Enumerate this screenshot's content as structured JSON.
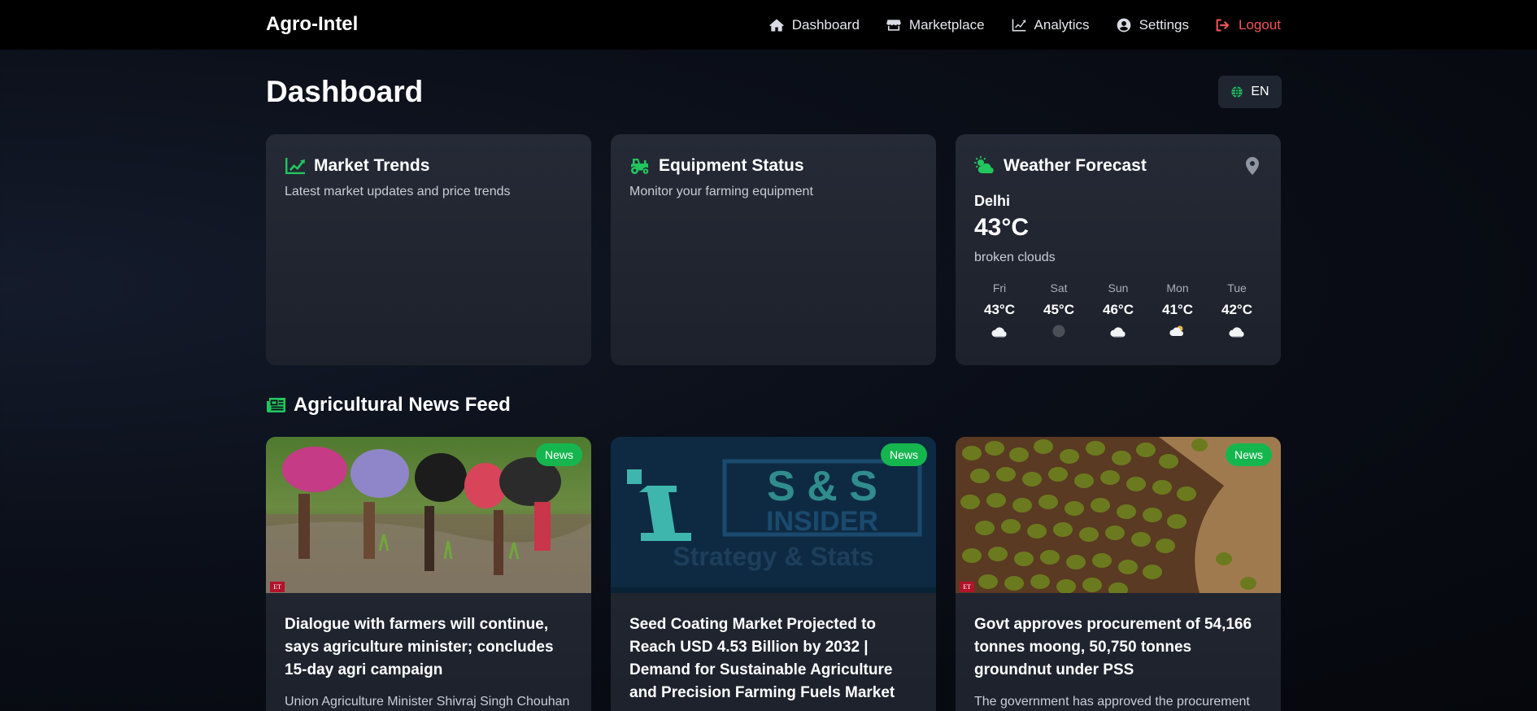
{
  "nav": {
    "brand": "Agro-Intel",
    "links": [
      {
        "label": "Dashboard",
        "icon": "home-icon"
      },
      {
        "label": "Marketplace",
        "icon": "store-icon"
      },
      {
        "label": "Analytics",
        "icon": "chart-line-icon"
      },
      {
        "label": "Settings",
        "icon": "user-circle-icon"
      },
      {
        "label": "Logout",
        "icon": "sign-out-icon"
      }
    ],
    "logout_color": "#f2545b"
  },
  "header": {
    "title": "Dashboard",
    "language": "EN"
  },
  "cards": {
    "market": {
      "title": "Market Trends",
      "subtitle": "Latest market updates and price trends",
      "icon": "chart-line-icon"
    },
    "equipment": {
      "title": "Equipment Status",
      "subtitle": "Monitor your farming equipment",
      "icon": "tractor-icon"
    },
    "weather": {
      "title": "Weather Forecast",
      "icon": "cloud-sun-icon",
      "city": "Delhi",
      "temp": "43°C",
      "description": "broken clouds",
      "forecast": [
        {
          "day": "Fri",
          "temp": "43°C",
          "icon": "cloud-icon"
        },
        {
          "day": "Sat",
          "temp": "45°C",
          "icon": "dark-cloud-icon"
        },
        {
          "day": "Sun",
          "temp": "46°C",
          "icon": "cloud-icon"
        },
        {
          "day": "Mon",
          "temp": "41°C",
          "icon": "cloud-sun-icon"
        },
        {
          "day": "Tue",
          "temp": "42°C",
          "icon": "cloud-icon"
        }
      ]
    }
  },
  "news": {
    "heading": "Agricultural News Feed",
    "items": [
      {
        "badge": "News",
        "title": "Dialogue with farmers will continue, says agriculture minister; concludes 15-day agri campaign",
        "description": "Union Agriculture Minister Shivraj Singh Chouhan"
      },
      {
        "badge": "News",
        "title": "Seed Coating Market Projected to Reach USD 4.53 Billion by 2032 | Demand for Sustainable Agriculture and Precision Farming Fuels Market",
        "description": ""
      },
      {
        "badge": "News",
        "title": "Govt approves procurement of 54,166 tonnes moong, 50,750 tonnes groundnut under PSS",
        "description": "The government has approved the procurement"
      }
    ],
    "image_logo_text": "S & S INSIDER",
    "image_logo_tagline": "Strategy & Stats",
    "et_logo": "ET"
  },
  "colors": {
    "accent_green": "#22c55e",
    "badge_green": "#16b64f",
    "card_bg": "#222733",
    "nav_bg": "#000000"
  }
}
